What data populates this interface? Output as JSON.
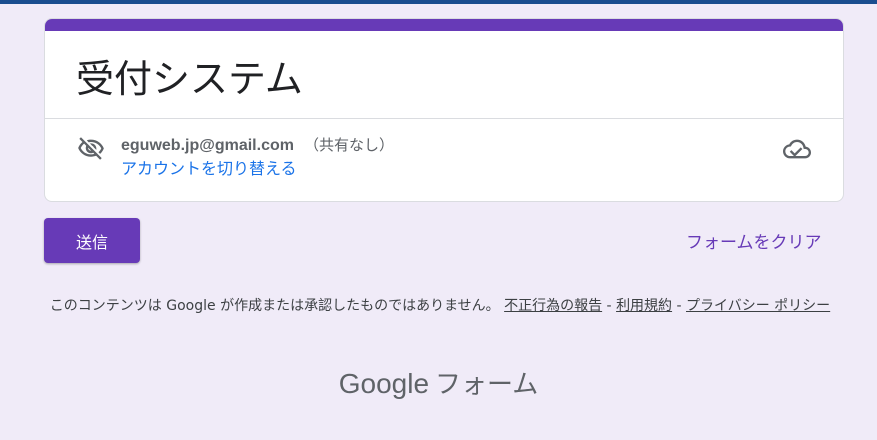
{
  "form": {
    "title": "受付システム"
  },
  "account": {
    "email": "eguweb.jp@gmail.com",
    "share_status": "（共有なし）",
    "switch_label": "アカウントを切り替える"
  },
  "icons": {
    "visibility": "eye-off-icon",
    "cloud": "cloud-done-icon"
  },
  "actions": {
    "submit_label": "送信",
    "clear_label": "フォームをクリア"
  },
  "footer": {
    "disclaimer_text": "このコンテンツは Google が作成または承認したものではありません。",
    "report_label": "不正行為の報告",
    "separator": " - ",
    "terms_label": "利用規約",
    "privacy_label": "プライバシー ポリシー",
    "brand_google": "Google",
    "brand_forms": "フォーム"
  },
  "colors": {
    "accent": "#673ab7",
    "background": "#f0ebf8",
    "link": "#1a73e8"
  }
}
